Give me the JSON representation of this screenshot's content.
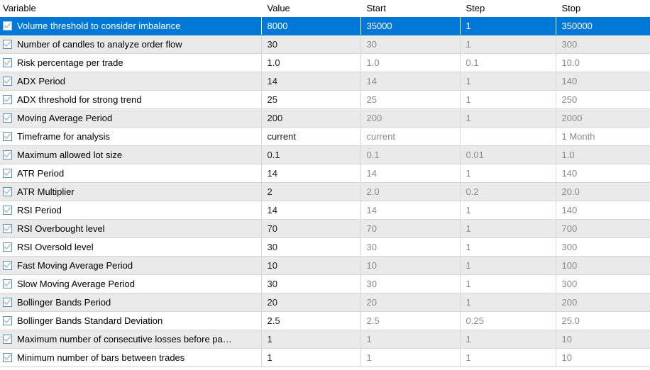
{
  "table": {
    "columns": [
      {
        "key": "variable",
        "label": "Variable"
      },
      {
        "key": "value",
        "label": "Value"
      },
      {
        "key": "start",
        "label": "Start"
      },
      {
        "key": "step",
        "label": "Step"
      },
      {
        "key": "stop",
        "label": "Stop"
      }
    ],
    "selected_row_index": 0,
    "selection_color": "#0078d7",
    "alt_row_color": "#eaeaea",
    "row_color": "#ffffff",
    "grid_line_color": "#d7d7d7",
    "muted_text_color": "#8a8a8a",
    "checkbox_icon": "checkbox-checked-icon",
    "rows": [
      {
        "checked": true,
        "variable": "Volume threshold to consider imbalance",
        "value": "8000",
        "start": "35000",
        "step": "1",
        "stop": "350000"
      },
      {
        "checked": true,
        "variable": "Number of candles to analyze order flow",
        "value": "30",
        "start": "30",
        "step": "1",
        "stop": "300"
      },
      {
        "checked": true,
        "variable": "Risk percentage per trade",
        "value": "1.0",
        "start": "1.0",
        "step": "0.1",
        "stop": "10.0"
      },
      {
        "checked": true,
        "variable": "ADX Period",
        "value": "14",
        "start": "14",
        "step": "1",
        "stop": "140"
      },
      {
        "checked": true,
        "variable": "ADX threshold for strong trend",
        "value": "25",
        "start": "25",
        "step": "1",
        "stop": "250"
      },
      {
        "checked": true,
        "variable": "Moving Average Period",
        "value": "200",
        "start": "200",
        "step": "1",
        "stop": "2000"
      },
      {
        "checked": true,
        "variable": "Timeframe for analysis",
        "value": "current",
        "start": "current",
        "step": "",
        "stop": "1 Month"
      },
      {
        "checked": true,
        "variable": "Maximum allowed lot size",
        "value": "0.1",
        "start": "0.1",
        "step": "0.01",
        "stop": "1.0"
      },
      {
        "checked": true,
        "variable": "ATR Period",
        "value": "14",
        "start": "14",
        "step": "1",
        "stop": "140"
      },
      {
        "checked": true,
        "variable": "ATR Multiplier",
        "value": "2",
        "start": "2.0",
        "step": "0.2",
        "stop": "20.0"
      },
      {
        "checked": true,
        "variable": "RSI Period",
        "value": "14",
        "start": "14",
        "step": "1",
        "stop": "140"
      },
      {
        "checked": true,
        "variable": "RSI Overbought level",
        "value": "70",
        "start": "70",
        "step": "1",
        "stop": "700"
      },
      {
        "checked": true,
        "variable": "RSI Oversold level",
        "value": "30",
        "start": "30",
        "step": "1",
        "stop": "300"
      },
      {
        "checked": true,
        "variable": "Fast Moving Average Period",
        "value": "10",
        "start": "10",
        "step": "1",
        "stop": "100"
      },
      {
        "checked": true,
        "variable": "Slow Moving Average Period",
        "value": "30",
        "start": "30",
        "step": "1",
        "stop": "300"
      },
      {
        "checked": true,
        "variable": "Bollinger Bands Period",
        "value": "20",
        "start": "20",
        "step": "1",
        "stop": "200"
      },
      {
        "checked": true,
        "variable": "Bollinger Bands Standard Deviation",
        "value": "2.5",
        "start": "2.5",
        "step": "0.25",
        "stop": "25.0"
      },
      {
        "checked": true,
        "variable": "Maximum number of consecutive losses before pa…",
        "value": "1",
        "start": "1",
        "step": "1",
        "stop": "10"
      },
      {
        "checked": true,
        "variable": "Minimum number of bars between trades",
        "value": "1",
        "start": "1",
        "step": "1",
        "stop": "10"
      }
    ]
  }
}
